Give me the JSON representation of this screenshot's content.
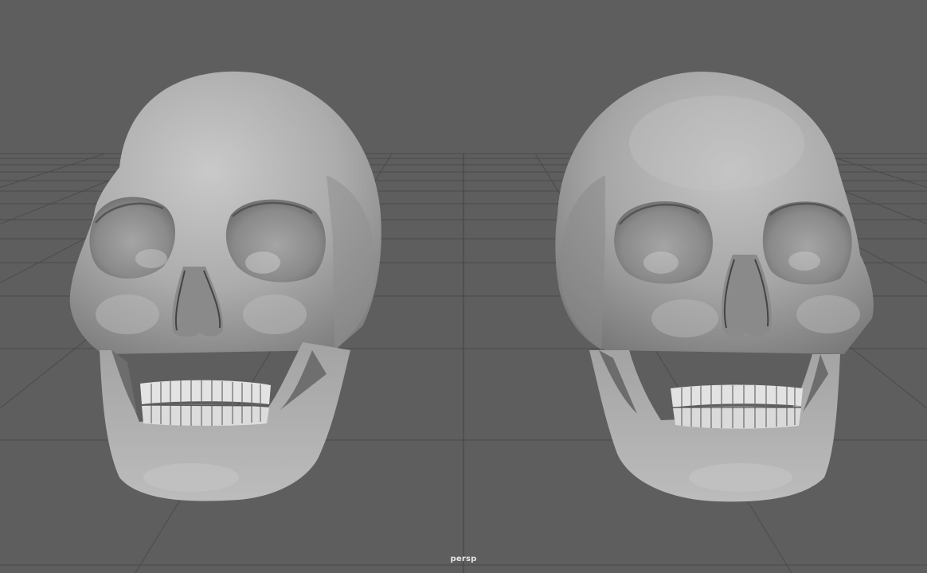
{
  "viewport": {
    "camera_label": "persp"
  },
  "scene": {
    "objects": [
      "skull",
      "skull"
    ],
    "background_color": "#5e5e5e",
    "grid_color": "#4a4a4a",
    "horizon_color": "#6a6a6a"
  }
}
